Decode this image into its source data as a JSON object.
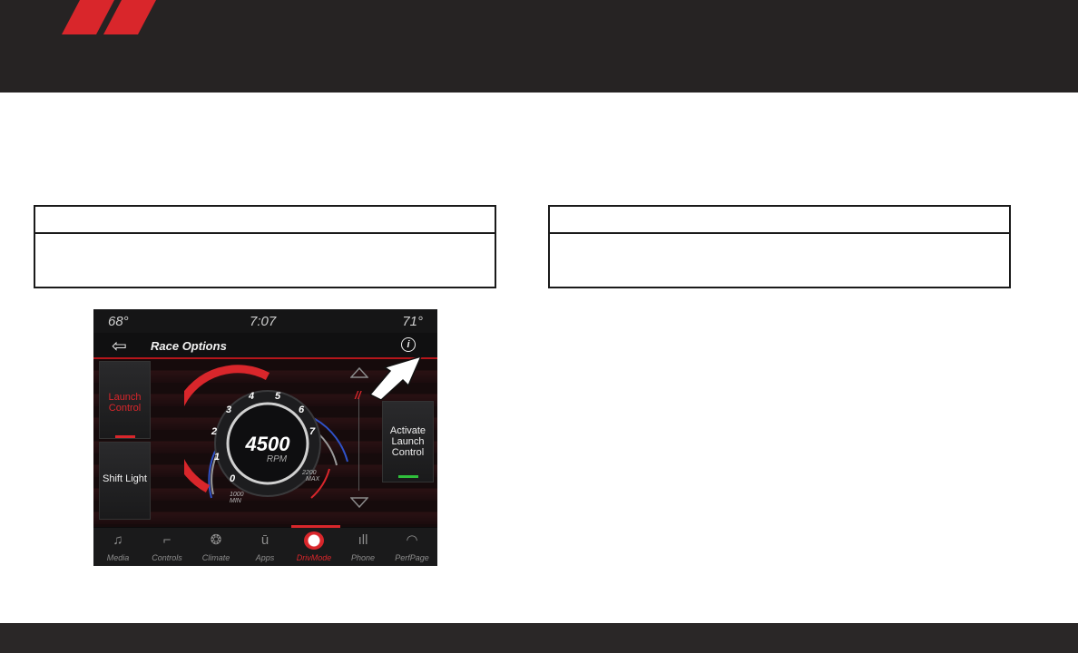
{
  "colors": {
    "brand_red": "#d9262b",
    "header_bg": "#262323",
    "active_green": "#2fbf3b"
  },
  "screen": {
    "status": {
      "temp_left": "68°",
      "time": "7:07",
      "temp_right": "71°"
    },
    "title": "Race Options",
    "info_icon_glyph": "i",
    "buttons": {
      "launch_control": "Launch Control",
      "shift_light": "Shift Light",
      "activate_launch_control": "Activate Launch Control"
    },
    "gauge": {
      "rpm_value": "4500",
      "rpm_unit": "RPM",
      "ticks": [
        "0",
        "1",
        "2",
        "3",
        "4",
        "5",
        "6",
        "7"
      ],
      "min_value": "1000",
      "min_label": "MIN",
      "max_value": "2200",
      "max_label": "MAX"
    },
    "nav": [
      {
        "label": "Media",
        "icon": "music-note-icon",
        "glyph": "♫"
      },
      {
        "label": "Controls",
        "icon": "seat-icon",
        "glyph": "⌐"
      },
      {
        "label": "Climate",
        "icon": "climate-icon",
        "glyph": "❂"
      },
      {
        "label": "Apps",
        "icon": "apps-icon",
        "glyph": "ū"
      },
      {
        "label": "DrivMode",
        "icon": "steering-wheel-icon",
        "glyph": ""
      },
      {
        "label": "Phone",
        "icon": "phone-signal-icon",
        "glyph": "ıll"
      },
      {
        "label": "PerfPage",
        "icon": "gauge-icon",
        "glyph": "◠"
      }
    ]
  }
}
